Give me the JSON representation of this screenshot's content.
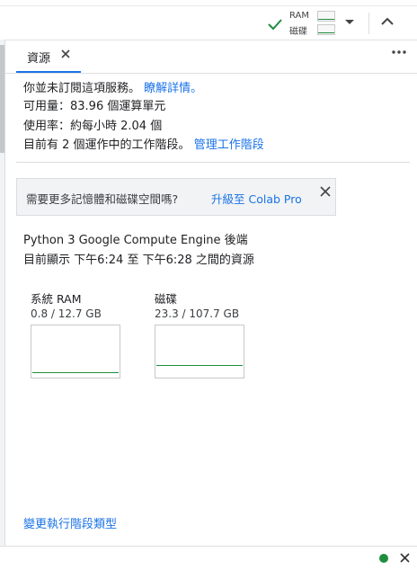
{
  "toolbar": {
    "ram_label": "RAM",
    "disk_label": "磁碟",
    "accent": "#1e8e3e"
  },
  "panel": {
    "tab_label": "資源",
    "close_icon": "close-icon",
    "more_icon": "more-vert-icon"
  },
  "subscription": {
    "line1_text": "你並未訂閱這項服務。",
    "learn_more": "瞭解詳情。",
    "available_text": "可用量：83.96 個運算單元",
    "usage_text": "使用率：約每小時 2.04 個",
    "sessions_text": "目前有 2 個運作中的工作階段。",
    "manage_link": "管理工作階段"
  },
  "upsell": {
    "text": "需要更多記憶體和磁碟空間嗎?",
    "link": "升級至 Colab Pro"
  },
  "backend": {
    "name": "Python 3 Google Compute Engine 後端",
    "range": "目前顯示 下午6:24 至 下午6:28 之間的資源"
  },
  "metrics": {
    "ram": {
      "title": "系統 RAM",
      "value": "0.8 / 12.7 GB",
      "fraction": 0.063
    },
    "disk": {
      "title": "磁碟",
      "value": "23.3 / 107.7 GB",
      "fraction": 0.216
    }
  },
  "footer": {
    "change_runtime": "變更執行階段類型",
    "status_color": "#1e8e3e"
  }
}
